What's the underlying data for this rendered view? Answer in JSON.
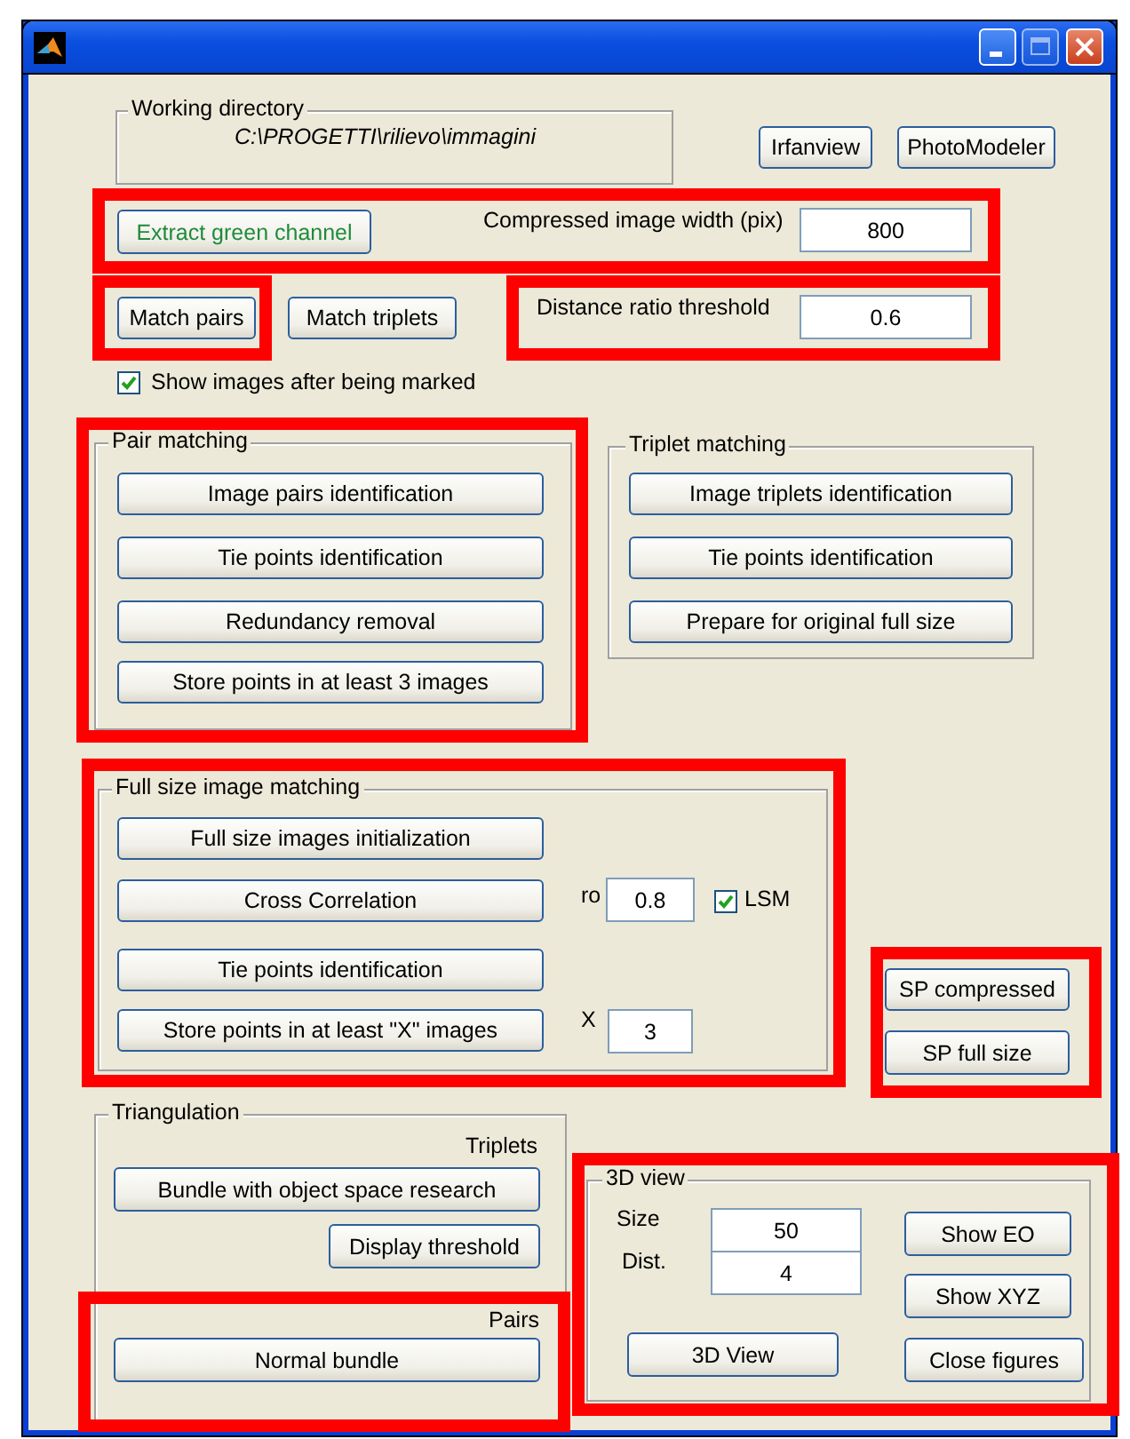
{
  "working_directory": {
    "label": "Working directory",
    "path": "C:\\PROGETTI\\rilievo\\immagini"
  },
  "tool_buttons": [
    "Irfanview",
    "PhotoModeler"
  ],
  "extract_button": "Extract green channel",
  "compressed_width": {
    "label": "Compressed image width (pix)",
    "value": "800"
  },
  "match_buttons": [
    "Match pairs",
    "Match triplets"
  ],
  "distance_ratio": {
    "label": "Distance ratio threshold",
    "value": "0.6"
  },
  "show_images": {
    "label": "Show images after being marked",
    "checked": true
  },
  "pair_matching": {
    "title": "Pair matching",
    "buttons": [
      "Image pairs identification",
      "Tie points identification",
      "Redundancy removal",
      "Store points in at least 3 images"
    ]
  },
  "triplet_matching": {
    "title": "Triplet matching",
    "buttons": [
      "Image triplets identification",
      "Tie points identification",
      "Prepare for original full size"
    ]
  },
  "full_size": {
    "title": "Full size image matching",
    "buttons": [
      "Full size images initialization",
      "Cross Correlation",
      "Tie points identification",
      "Store points in at least \"X\" images"
    ],
    "ro": {
      "label": "ro",
      "value": "0.8"
    },
    "lsm": {
      "label": "LSM",
      "checked": true
    },
    "x": {
      "label": "X",
      "value": "3"
    }
  },
  "sp_buttons": [
    "SP compressed",
    "SP full size"
  ],
  "triangulation": {
    "title": "Triangulation",
    "triplets_label": "Triplets",
    "triplet_buttons": [
      "Bundle with object space research",
      "Display threshold"
    ],
    "pairs_label": "Pairs",
    "pair_buttons": [
      "Normal bundle"
    ]
  },
  "view_3d": {
    "title": "3D view",
    "size": {
      "label": "Size",
      "value": "50"
    },
    "dist": {
      "label": "Dist.",
      "value": "4"
    },
    "view_button": "3D View",
    "buttons": [
      "Show EO",
      "Show XYZ",
      "Close figures"
    ]
  }
}
